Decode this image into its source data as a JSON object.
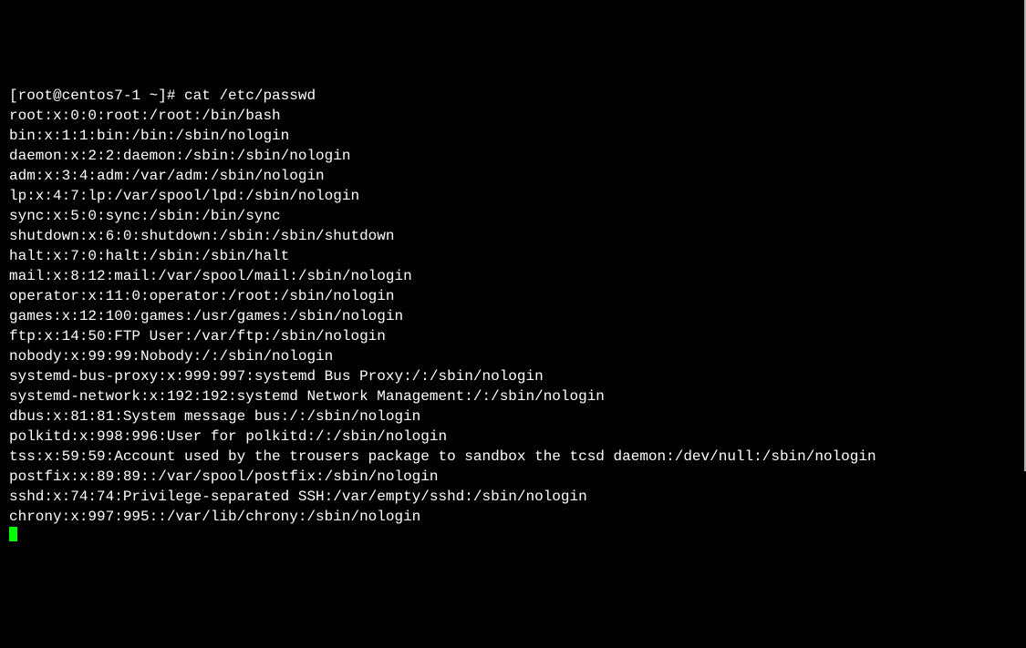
{
  "prompt": {
    "user": "root",
    "host": "centos7-1",
    "cwd": "~",
    "symbol": "#",
    "full": "[root@centos7-1 ~]# "
  },
  "command": "cat /etc/passwd",
  "lines": [
    "root:x:0:0:root:/root:/bin/bash",
    "bin:x:1:1:bin:/bin:/sbin/nologin",
    "daemon:x:2:2:daemon:/sbin:/sbin/nologin",
    "adm:x:3:4:adm:/var/adm:/sbin/nologin",
    "lp:x:4:7:lp:/var/spool/lpd:/sbin/nologin",
    "sync:x:5:0:sync:/sbin:/bin/sync",
    "shutdown:x:6:0:shutdown:/sbin:/sbin/shutdown",
    "halt:x:7:0:halt:/sbin:/sbin/halt",
    "mail:x:8:12:mail:/var/spool/mail:/sbin/nologin",
    "operator:x:11:0:operator:/root:/sbin/nologin",
    "games:x:12:100:games:/usr/games:/sbin/nologin",
    "ftp:x:14:50:FTP User:/var/ftp:/sbin/nologin",
    "nobody:x:99:99:Nobody:/:/sbin/nologin",
    "systemd-bus-proxy:x:999:997:systemd Bus Proxy:/:/sbin/nologin",
    "systemd-network:x:192:192:systemd Network Management:/:/sbin/nologin",
    "dbus:x:81:81:System message bus:/:/sbin/nologin",
    "polkitd:x:998:996:User for polkitd:/:/sbin/nologin",
    "tss:x:59:59:Account used by the trousers package to sandbox the tcsd daemon:/dev/null:/sbin/nologin",
    "postfix:x:89:89::/var/spool/postfix:/sbin/nologin",
    "sshd:x:74:74:Privilege-separated SSH:/var/empty/sshd:/sbin/nologin",
    "chrony:x:997:995::/var/lib/chrony:/sbin/nologin"
  ]
}
